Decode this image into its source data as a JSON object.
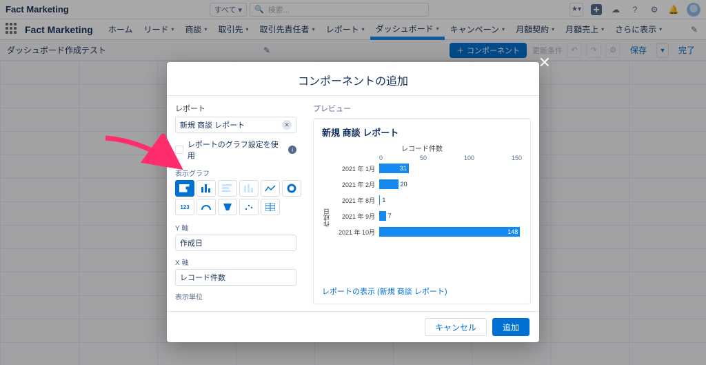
{
  "global": {
    "brand": "Fact Marketing",
    "obj_switch": "すべて ▾",
    "search_placeholder": "検索..."
  },
  "nav": {
    "app_name": "Fact Marketing",
    "items": [
      "ホーム",
      "リード",
      "商談",
      "取引先",
      "取引先責任者",
      "レポート",
      "ダッシュボード",
      "キャンペーン",
      "月額契約",
      "月額売上",
      "さらに表示"
    ],
    "active_index": 6
  },
  "builder": {
    "title": "ダッシュボード作成テスト",
    "component_btn": "コンポーネント",
    "refresh_placeholder": "更新条件",
    "save": "保存",
    "done": "完了"
  },
  "modal": {
    "title": "コンポーネントの追加",
    "report_label": "レポート",
    "report_value": "新規 商談 レポート",
    "use_report_chart": "レポートのグラフ設定を使用",
    "display_chart_label": "表示グラフ",
    "y_axis_label": "Y 軸",
    "y_axis_value": "作成日",
    "x_axis_label": "X 軸",
    "x_axis_value": "レコード件数",
    "display_unit_label": "表示単位",
    "preview_label": "プレビュー",
    "preview_title": "新規 商談 レポート",
    "view_report": "レポートの表示 (新規 商談 レポート)",
    "cancel": "キャンセル",
    "add": "追加"
  },
  "chart_data": {
    "type": "bar",
    "orientation": "horizontal",
    "title": "レコード件数",
    "xlabel": "レコード件数",
    "ylabel": "作成日",
    "xlim": [
      0,
      150
    ],
    "ticks": [
      0,
      50,
      100,
      150
    ],
    "categories": [
      "2021 年 1月",
      "2021 年 2月",
      "2021 年 8月",
      "2021 年 9月",
      "2021 年 10月"
    ],
    "values": [
      31,
      20,
      1,
      7,
      148
    ]
  },
  "colors": {
    "primary": "#0070d2",
    "accent": "#1589ee",
    "arrow": "#ff2d6b"
  }
}
